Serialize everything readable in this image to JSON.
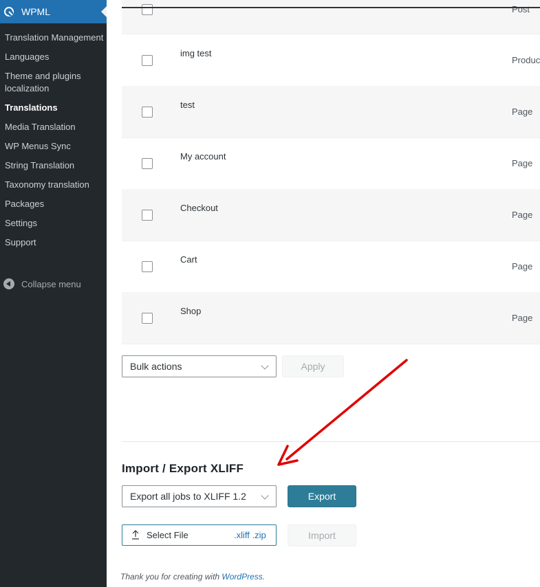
{
  "sidebar": {
    "menu_title": "WPML",
    "logo_icon": "wpml-logo-icon",
    "items": [
      {
        "label": "Translation Management"
      },
      {
        "label": "Languages"
      },
      {
        "label": "Theme and plugins localization"
      },
      {
        "label": "Translations"
      },
      {
        "label": "Media Translation"
      },
      {
        "label": "WP Menus Sync"
      },
      {
        "label": "String Translation"
      },
      {
        "label": "Taxonomy translation"
      },
      {
        "label": "Packages"
      },
      {
        "label": "Settings"
      },
      {
        "label": "Support"
      }
    ],
    "current_item": "Translations",
    "collapse_label": "Collapse menu"
  },
  "table": {
    "rows": [
      {
        "title": "",
        "type": "Post"
      },
      {
        "title": "img test",
        "type": "Product"
      },
      {
        "title": "test",
        "type": "Page"
      },
      {
        "title": "My account",
        "type": "Page"
      },
      {
        "title": "Checkout",
        "type": "Page"
      },
      {
        "title": "Cart",
        "type": "Page"
      },
      {
        "title": "Shop",
        "type": "Page"
      }
    ]
  },
  "bulk": {
    "select_value": "Bulk actions",
    "apply_label": "Apply"
  },
  "xliff": {
    "title": "Import / Export XLIFF",
    "export_select_value": "Export all jobs to XLIFF 1.2",
    "export_label": "Export",
    "file_label": "Select File",
    "file_ext": ".xliff .zip",
    "import_label": "Import"
  },
  "footer": {
    "text": "Thank you for creating with ",
    "link": "WordPress",
    "end": "."
  },
  "colors": {
    "sidebar_bg": "#23282d",
    "accent": "#2271b1",
    "export_button": "#2e7d98",
    "annotation_arrow": "#e00000"
  }
}
